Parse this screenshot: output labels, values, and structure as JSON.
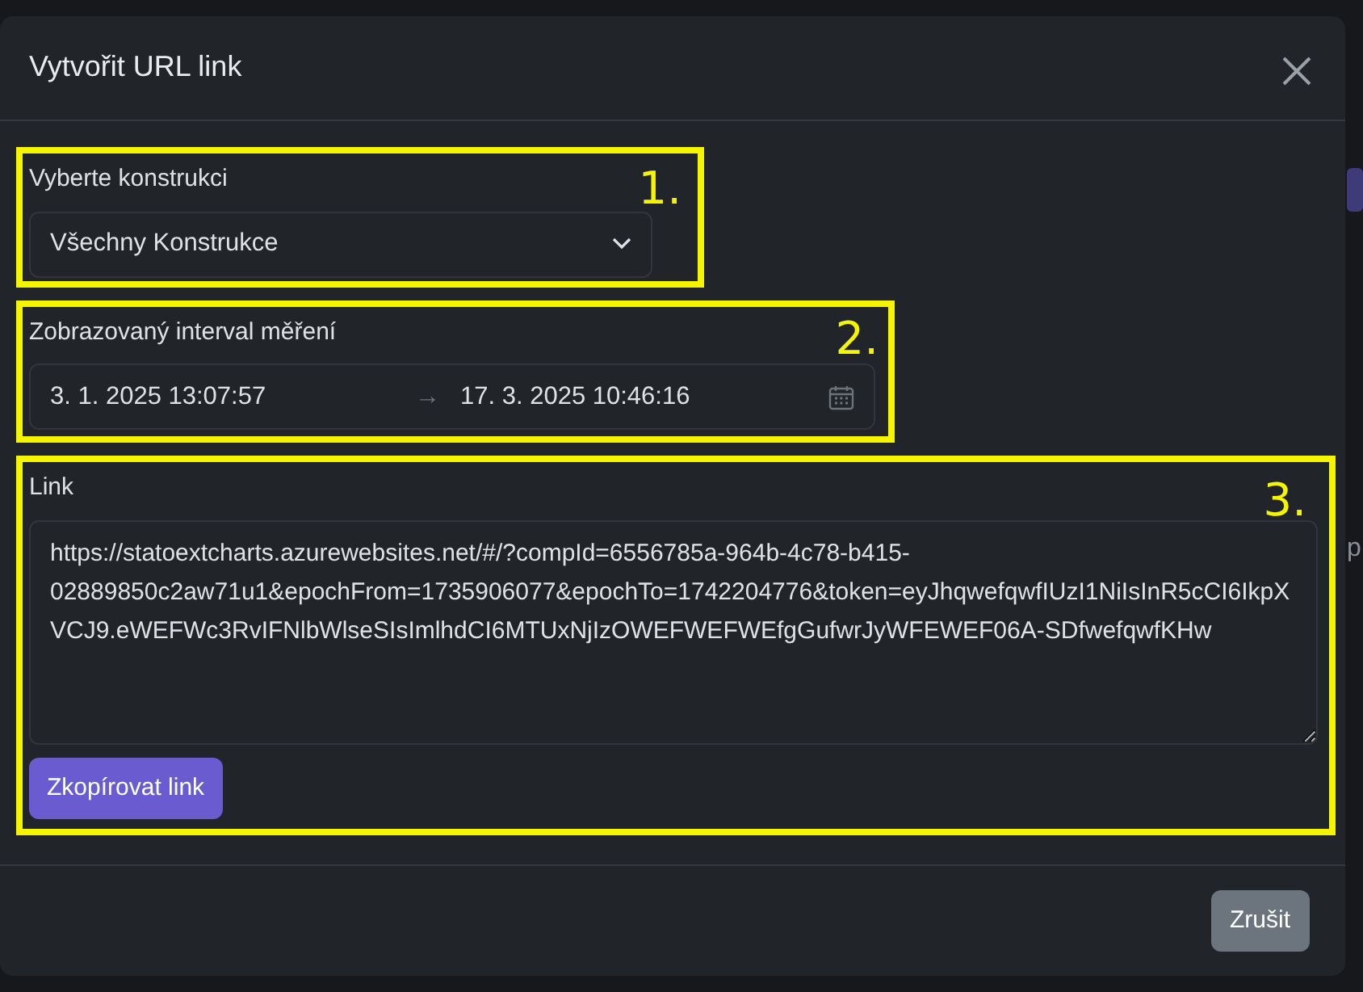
{
  "background_page": {
    "text_fragment": "p"
  },
  "dialog": {
    "title": "Vytvořit URL link",
    "sections": [
      {
        "kind": "select",
        "label": "Vyberte konstrukci",
        "value": "Všechny Konstrukce",
        "annotation": "1."
      },
      {
        "kind": "daterange",
        "label": "Zobrazovaný interval měření",
        "from": "3. 1. 2025 13:07:57",
        "separator": "→",
        "to": "17. 3. 2025 10:46:16",
        "annotation": "2."
      },
      {
        "kind": "link",
        "label": "Link",
        "value": "https://statoextcharts.azurewebsites.net/#/?compId=6556785a-964b-4c78-b415-02889850c2aw71u1&epochFrom=1735906077&epochTo=1742204776&token=eyJhqwefqwfIUzI1NiIsInR5cCI6IkpXVCJ9.eWEFWc3RvIFNlbWlseSIsImlhdCI6MTUxNjIzOWEFWEFWEfgGufwrJyWFEWEF06A-SDfwefqwfKHw",
        "button": "Zkopírovat link",
        "annotation": "3."
      }
    ],
    "footer_button": "Zrušit"
  }
}
